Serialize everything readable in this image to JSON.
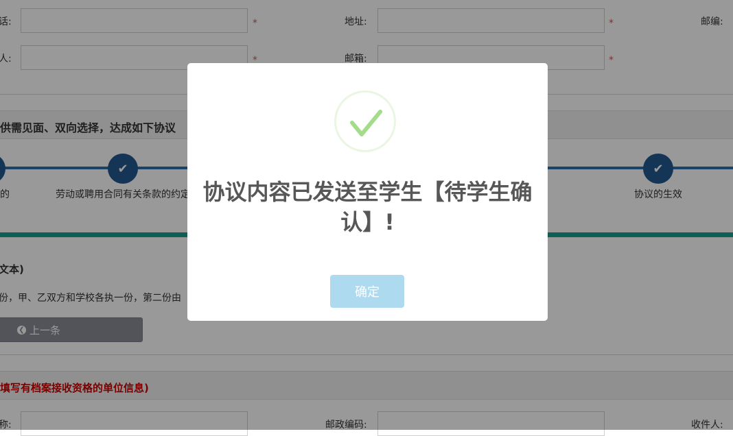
{
  "form_top": {
    "row1": {
      "label_left": "话:",
      "label_mid": "地址:",
      "label_right": "邮编:",
      "required": "*"
    },
    "row2": {
      "label_left": "人:",
      "label_mid": "邮箱:",
      "required": "*"
    }
  },
  "section1": {
    "title": "供需见面、双向选择，达成如下协议"
  },
  "steps": [
    {
      "label": "的"
    },
    {
      "label": "劳动或聘用合同有关条款的约定"
    },
    {
      "label": "协议的生效"
    }
  ],
  "agreement": {
    "heading": "文本)",
    "line": "份，甲、乙双方和学校各执一份，第二份由",
    "prev_button": "上一条"
  },
  "section2": {
    "title": "填写有档案接收资格的单位信息)"
  },
  "form_bottom": {
    "label_left": "称:",
    "label_mid": "邮政编码:",
    "label_right": "收件人:"
  },
  "modal": {
    "title": "协议内容已发送至学生【待学生确认】!",
    "confirm_button": "确定",
    "check_color": "#a4dc8c"
  }
}
